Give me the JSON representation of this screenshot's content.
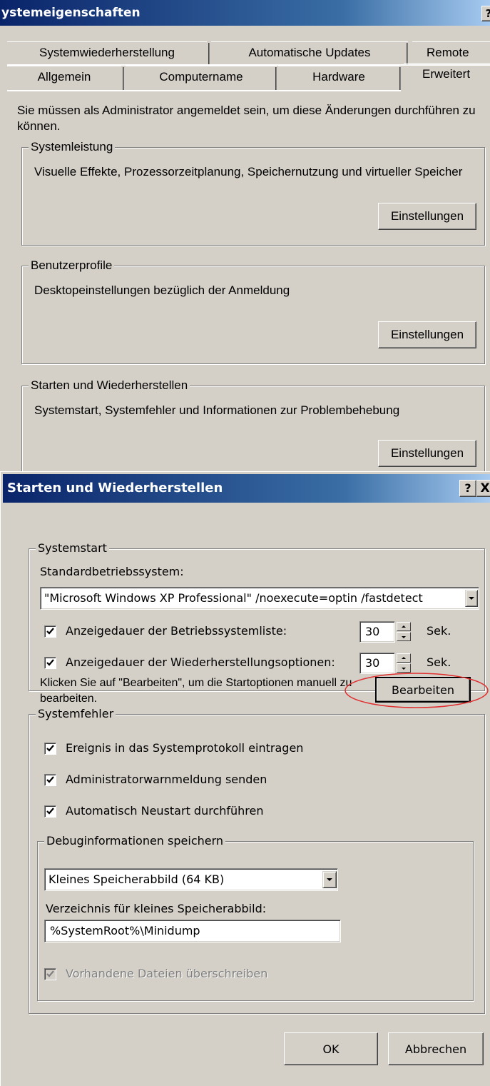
{
  "background_window": {
    "title": "ystemeigenschaften",
    "help_button": "?",
    "tabs_row1": [
      "Systemwiederherstellung",
      "Automatische Updates",
      "Remote"
    ],
    "tabs_row2": [
      "Allgemein",
      "Computername",
      "Hardware",
      "Erweitert"
    ],
    "active_tab": "Erweitert",
    "notice": "Sie müssen als Administrator angemeldet sein, um diese Änderungen durchführen zu können.",
    "groups": [
      {
        "title": "Systemleistung",
        "description": "Visuelle Effekte, Prozessorzeitplanung, Speichernutzung und virtueller Speicher",
        "button": "Einstellungen"
      },
      {
        "title": "Benutzerprofile",
        "description": "Desktopeinstellungen bezüglich der Anmeldung",
        "button": "Einstellungen"
      },
      {
        "title": "Starten und Wiederherstellen",
        "description": "Systemstart, Systemfehler und Informationen zur Problembehebung",
        "button": "Einstellungen"
      }
    ]
  },
  "dialog": {
    "title": "Starten und Wiederherstellen",
    "help_button": "?",
    "close_button": "X",
    "systemstart": {
      "group_title": "Systemstart",
      "os_label": "Standardbetriebssystem:",
      "os_value": "\"Microsoft Windows XP Professional\" /noexecute=optin /fastdetect",
      "list_checkbox_label": "Anzeigedauer der Betriebssystemliste:",
      "list_checked": true,
      "list_value": "30",
      "recovery_checkbox_label": "Anzeigedauer der Wiederherstellungsoptionen:",
      "recovery_checked": true,
      "recovery_value": "30",
      "unit": "Sek.",
      "edit_hint": "Klicken Sie auf \"Bearbeiten\", um die Startoptionen manuell zu bearbeiten.",
      "edit_button": "Bearbeiten"
    },
    "systemfehler": {
      "group_title": "Systemfehler",
      "checkboxes": [
        {
          "label": "Ereignis in das Systemprotokoll eintragen",
          "checked": true
        },
        {
          "label": "Administratorwarnmeldung senden",
          "checked": true
        },
        {
          "label": "Automatisch Neustart durchführen",
          "checked": true
        }
      ],
      "debug": {
        "group_title": "Debuginformationen speichern",
        "dump_type": "Kleines Speicherabbild (64 KB)",
        "dir_label": "Verzeichnis für kleines Speicherabbild:",
        "dir_value": "%SystemRoot%\\Minidump",
        "overwrite_label": "Vorhandene Dateien überschreiben",
        "overwrite_checked": true,
        "overwrite_disabled": true
      }
    },
    "ok_button": "OK",
    "cancel_button": "Abbrechen"
  },
  "colors": {
    "dialog_face": "#d4d0c8",
    "title_start": "#0a246a",
    "title_end": "#a6caf0",
    "highlight_ellipse": "#e03030"
  }
}
